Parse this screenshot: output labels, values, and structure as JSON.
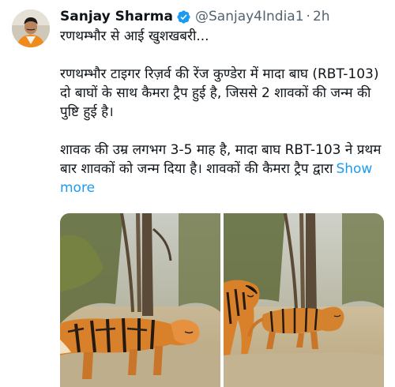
{
  "tweet": {
    "author": {
      "display_name": "Sanjay Sharma",
      "handle": "@Sanjay4India1",
      "verified": true,
      "avatar_icon": "profile-avatar"
    },
    "separator": "·",
    "time": "2h",
    "text": {
      "line1": "रणथम्भौर से आई खुशखबरी...",
      "para2": "रणथम्भौर टाइगर रिज़र्व की रेंज कुण्डेरा में मादा बाघ (RBT-103) दो बाघों के साथ कैमरा ट्रैप हुई है, जिससे 2 शावकों की जन्म की पुष्टि हुई है।",
      "para3": "शावक की उम्र लगभग 3-5 माह है, मादा बाघ RBT-103 ने प्रथम बार शावकों को जन्म दिया है। शावकों की कैमरा ट्रैप द्वारा",
      "show_more": "Show more"
    },
    "media": {
      "count": 2,
      "items": [
        "tiger-camera-trap-photo",
        "tigress-and-cub-camera-trap-photo"
      ]
    },
    "colors": {
      "link": "#1d9bf0",
      "verified_badge": "#1d9bf0",
      "secondary_text": "#536471"
    }
  }
}
